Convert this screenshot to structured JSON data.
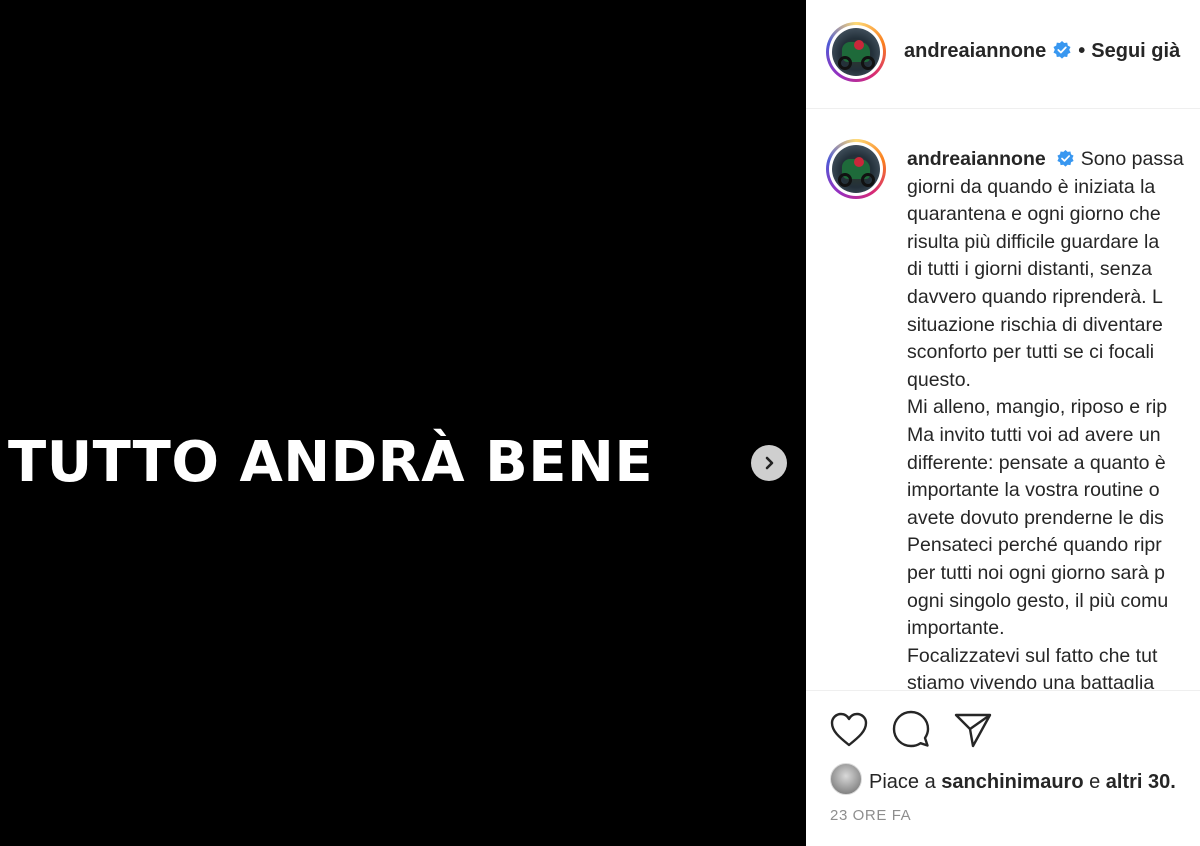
{
  "media": {
    "text": "TUTTO ANDRÀ BENE",
    "next_icon": "chevron-right-icon"
  },
  "header": {
    "username": "andreaiannone",
    "separator": "•",
    "follow_label": "Segui già"
  },
  "caption": {
    "username": "andreaiannone",
    "lines": [
      "Sono passa",
      "giorni da quando è iniziata la",
      "quarantena e ogni giorno che",
      "risulta più difficile guardare la",
      "di tutti i giorni distanti, senza",
      "davvero quando riprenderà. L",
      "situazione rischia di diventare",
      "sconforto per tutti se ci focali",
      "questo.",
      "Mi alleno, mangio, riposo e rip",
      "Ma invito tutti voi ad avere un",
      "differente: pensate a quanto è",
      "importante la vostra routine o",
      "avete dovuto prenderne le dis",
      "Pensateci perché quando ripr",
      "per tutti noi ogni giorno sarà p",
      "ogni singolo gesto, il più comu",
      "importante.",
      "Focalizzatevi sul fatto che tut",
      "stiamo vivendo una battaglia"
    ]
  },
  "actions": {
    "like_icon": "heart-icon",
    "comment_icon": "comment-icon",
    "share_icon": "share-icon"
  },
  "likes": {
    "prefix": "Piace a",
    "user": "sanchinimauro",
    "conjunction": "e",
    "others": "altri 30."
  },
  "timestamp": "23 ORE FA",
  "colors": {
    "media_bg": "#000000",
    "verified": "#3897f0",
    "text": "#262626",
    "muted": "#8e8e8e"
  }
}
